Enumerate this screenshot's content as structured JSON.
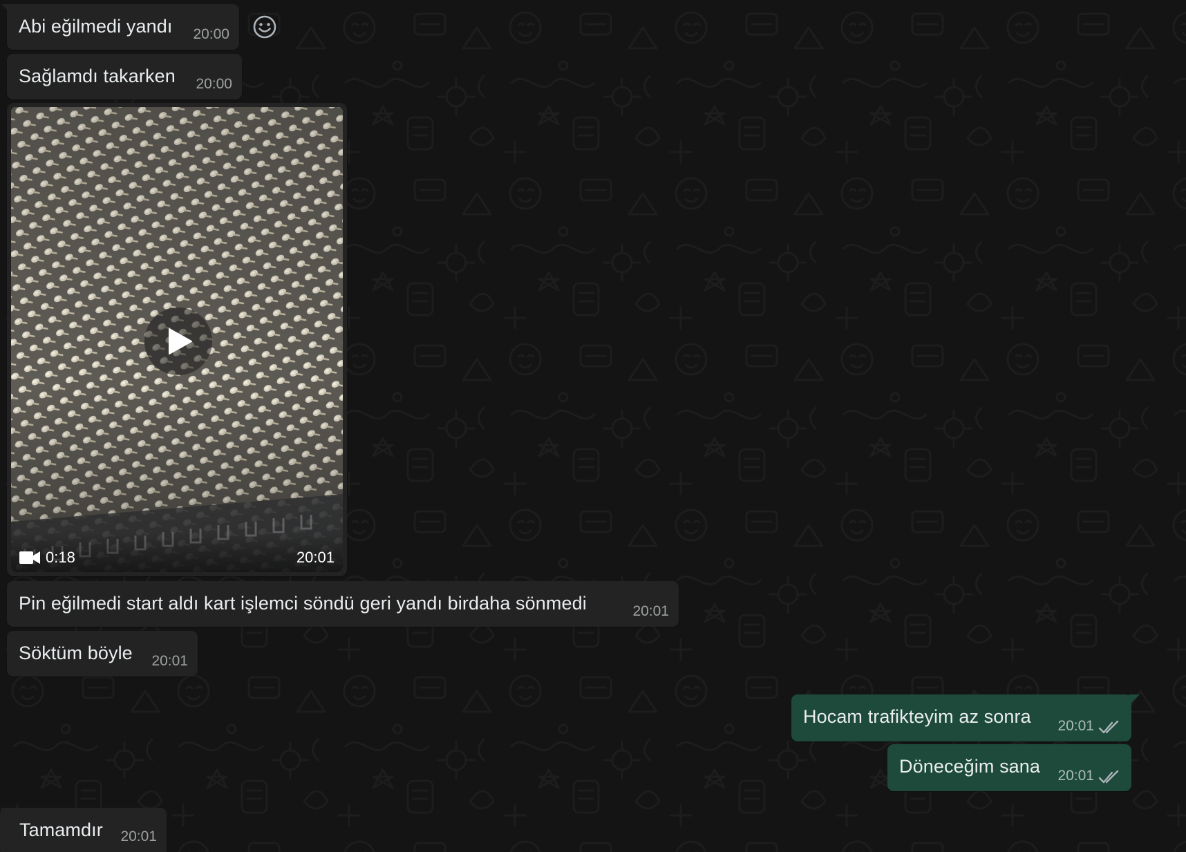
{
  "colors": {
    "background": "#141414",
    "incoming_bubble": "#232323",
    "outgoing_bubble": "#1d4a3a",
    "text": "#e9edef",
    "timestamp": "#9aa0a4"
  },
  "messages": [
    {
      "direction": "in",
      "text": "Abi eğilmedi yandı",
      "time": "20:00"
    },
    {
      "direction": "in",
      "text": "Sağlamdı takarken",
      "time": "20:00"
    },
    {
      "direction": "in",
      "type": "video",
      "duration": "0:18",
      "time": "20:01"
    },
    {
      "direction": "in",
      "text": "Pin eğilmedi start aldı kart işlemci söndü geri yandı birdaha sönmedi",
      "time": "20:01"
    },
    {
      "direction": "in",
      "text": "Söktüm böyle",
      "time": "20:01"
    },
    {
      "direction": "out",
      "text": "Hocam trafikteyim az sonra",
      "time": "20:01",
      "status": "read"
    },
    {
      "direction": "out",
      "text": "Döneceğim sana",
      "time": "20:01",
      "status": "read"
    },
    {
      "direction": "in",
      "text": "Tamamdır",
      "time": "20:01"
    }
  ],
  "icons": {
    "reaction": "smiley-icon",
    "video": "video-camera-icon",
    "play": "play-icon",
    "read_receipt": "double-check-icon"
  }
}
